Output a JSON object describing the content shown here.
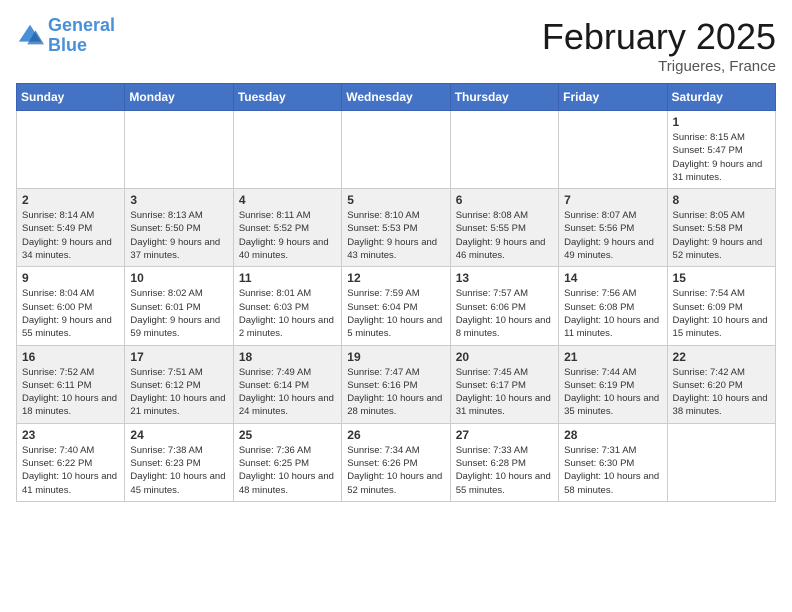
{
  "logo": {
    "line1": "General",
    "line2": "Blue"
  },
  "title": "February 2025",
  "location": "Trigueres, France",
  "weekdays": [
    "Sunday",
    "Monday",
    "Tuesday",
    "Wednesday",
    "Thursday",
    "Friday",
    "Saturday"
  ],
  "weeks": [
    [
      {
        "day": "",
        "info": ""
      },
      {
        "day": "",
        "info": ""
      },
      {
        "day": "",
        "info": ""
      },
      {
        "day": "",
        "info": ""
      },
      {
        "day": "",
        "info": ""
      },
      {
        "day": "",
        "info": ""
      },
      {
        "day": "1",
        "info": "Sunrise: 8:15 AM\nSunset: 5:47 PM\nDaylight: 9 hours and 31 minutes."
      }
    ],
    [
      {
        "day": "2",
        "info": "Sunrise: 8:14 AM\nSunset: 5:49 PM\nDaylight: 9 hours and 34 minutes."
      },
      {
        "day": "3",
        "info": "Sunrise: 8:13 AM\nSunset: 5:50 PM\nDaylight: 9 hours and 37 minutes."
      },
      {
        "day": "4",
        "info": "Sunrise: 8:11 AM\nSunset: 5:52 PM\nDaylight: 9 hours and 40 minutes."
      },
      {
        "day": "5",
        "info": "Sunrise: 8:10 AM\nSunset: 5:53 PM\nDaylight: 9 hours and 43 minutes."
      },
      {
        "day": "6",
        "info": "Sunrise: 8:08 AM\nSunset: 5:55 PM\nDaylight: 9 hours and 46 minutes."
      },
      {
        "day": "7",
        "info": "Sunrise: 8:07 AM\nSunset: 5:56 PM\nDaylight: 9 hours and 49 minutes."
      },
      {
        "day": "8",
        "info": "Sunrise: 8:05 AM\nSunset: 5:58 PM\nDaylight: 9 hours and 52 minutes."
      }
    ],
    [
      {
        "day": "9",
        "info": "Sunrise: 8:04 AM\nSunset: 6:00 PM\nDaylight: 9 hours and 55 minutes."
      },
      {
        "day": "10",
        "info": "Sunrise: 8:02 AM\nSunset: 6:01 PM\nDaylight: 9 hours and 59 minutes."
      },
      {
        "day": "11",
        "info": "Sunrise: 8:01 AM\nSunset: 6:03 PM\nDaylight: 10 hours and 2 minutes."
      },
      {
        "day": "12",
        "info": "Sunrise: 7:59 AM\nSunset: 6:04 PM\nDaylight: 10 hours and 5 minutes."
      },
      {
        "day": "13",
        "info": "Sunrise: 7:57 AM\nSunset: 6:06 PM\nDaylight: 10 hours and 8 minutes."
      },
      {
        "day": "14",
        "info": "Sunrise: 7:56 AM\nSunset: 6:08 PM\nDaylight: 10 hours and 11 minutes."
      },
      {
        "day": "15",
        "info": "Sunrise: 7:54 AM\nSunset: 6:09 PM\nDaylight: 10 hours and 15 minutes."
      }
    ],
    [
      {
        "day": "16",
        "info": "Sunrise: 7:52 AM\nSunset: 6:11 PM\nDaylight: 10 hours and 18 minutes."
      },
      {
        "day": "17",
        "info": "Sunrise: 7:51 AM\nSunset: 6:12 PM\nDaylight: 10 hours and 21 minutes."
      },
      {
        "day": "18",
        "info": "Sunrise: 7:49 AM\nSunset: 6:14 PM\nDaylight: 10 hours and 24 minutes."
      },
      {
        "day": "19",
        "info": "Sunrise: 7:47 AM\nSunset: 6:16 PM\nDaylight: 10 hours and 28 minutes."
      },
      {
        "day": "20",
        "info": "Sunrise: 7:45 AM\nSunset: 6:17 PM\nDaylight: 10 hours and 31 minutes."
      },
      {
        "day": "21",
        "info": "Sunrise: 7:44 AM\nSunset: 6:19 PM\nDaylight: 10 hours and 35 minutes."
      },
      {
        "day": "22",
        "info": "Sunrise: 7:42 AM\nSunset: 6:20 PM\nDaylight: 10 hours and 38 minutes."
      }
    ],
    [
      {
        "day": "23",
        "info": "Sunrise: 7:40 AM\nSunset: 6:22 PM\nDaylight: 10 hours and 41 minutes."
      },
      {
        "day": "24",
        "info": "Sunrise: 7:38 AM\nSunset: 6:23 PM\nDaylight: 10 hours and 45 minutes."
      },
      {
        "day": "25",
        "info": "Sunrise: 7:36 AM\nSunset: 6:25 PM\nDaylight: 10 hours and 48 minutes."
      },
      {
        "day": "26",
        "info": "Sunrise: 7:34 AM\nSunset: 6:26 PM\nDaylight: 10 hours and 52 minutes."
      },
      {
        "day": "27",
        "info": "Sunrise: 7:33 AM\nSunset: 6:28 PM\nDaylight: 10 hours and 55 minutes."
      },
      {
        "day": "28",
        "info": "Sunrise: 7:31 AM\nSunset: 6:30 PM\nDaylight: 10 hours and 58 minutes."
      },
      {
        "day": "",
        "info": ""
      }
    ]
  ]
}
